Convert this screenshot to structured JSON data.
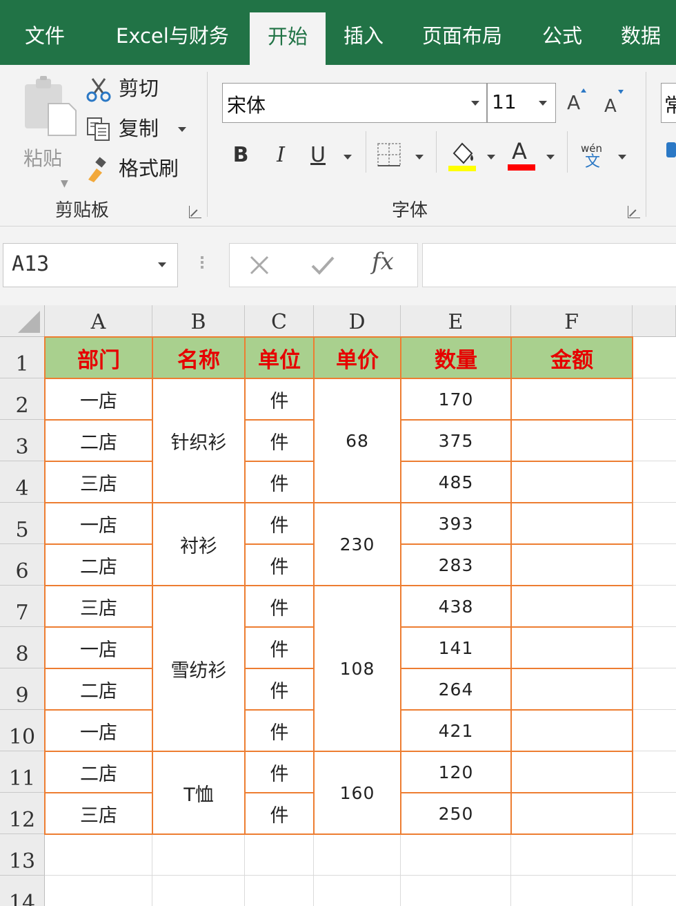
{
  "tabs": [
    {
      "label": "文件",
      "active": false
    },
    {
      "label": "Excel与财务",
      "active": false
    },
    {
      "label": "开始",
      "active": true
    },
    {
      "label": "插入",
      "active": false
    },
    {
      "label": "页面布局",
      "active": false
    },
    {
      "label": "公式",
      "active": false
    },
    {
      "label": "数据",
      "active": false
    }
  ],
  "clipboard": {
    "paste": "粘贴",
    "cut": "剪切",
    "copy": "复制",
    "format_painter": "格式刷",
    "group_label": "剪贴板"
  },
  "font": {
    "name": "宋体",
    "size": "11",
    "bold": "B",
    "italic": "I",
    "underline": "U",
    "font_color_glyph": "A",
    "phonetic_top": "wén",
    "phonetic_bottom": "文",
    "group_label": "字体",
    "highlight_color": "#ffff00",
    "font_color": "#ff0000"
  },
  "next_group_partial": "常",
  "formula_bar": {
    "name_box": "A13",
    "fx": "fx",
    "value": ""
  },
  "colors": {
    "ribbon_green": "#217346",
    "header_fill": "#a9d08e",
    "header_text": "#e60000",
    "table_border": "#ed7d31"
  },
  "sheet": {
    "columns": [
      "A",
      "B",
      "C",
      "D",
      "E",
      "F"
    ],
    "rows": [
      "1",
      "2",
      "3",
      "4",
      "5",
      "6",
      "7",
      "8",
      "9",
      "10",
      "11",
      "12",
      "13",
      "14"
    ],
    "headers": [
      "部门",
      "名称",
      "单位",
      "单价",
      "数量",
      "金额"
    ],
    "dept": [
      "一店",
      "二店",
      "三店",
      "一店",
      "二店",
      "三店",
      "一店",
      "二店",
      "一店",
      "二店",
      "三店"
    ],
    "unit": [
      "件",
      "件",
      "件",
      "件",
      "件",
      "件",
      "件",
      "件",
      "件",
      "件",
      "件"
    ],
    "qty": [
      "170",
      "375",
      "485",
      "393",
      "283",
      "438",
      "141",
      "264",
      "421",
      "120",
      "250"
    ],
    "names": [
      {
        "text": "针织衫",
        "start": 0,
        "span": 3
      },
      {
        "text": "衬衫",
        "start": 3,
        "span": 2
      },
      {
        "text": "雪纺衫",
        "start": 5,
        "span": 4
      },
      {
        "text": "T恤",
        "start": 9,
        "span": 2
      }
    ],
    "prices": [
      {
        "text": "68",
        "start": 0,
        "span": 3
      },
      {
        "text": "230",
        "start": 3,
        "span": 2
      },
      {
        "text": "108",
        "start": 5,
        "span": 4
      },
      {
        "text": "160",
        "start": 9,
        "span": 2
      }
    ]
  }
}
